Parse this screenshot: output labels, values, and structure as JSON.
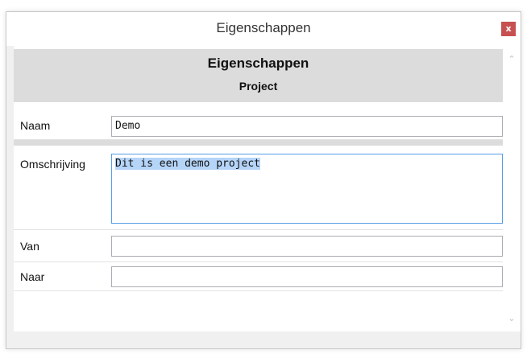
{
  "window": {
    "title": "Eigenschappen",
    "close_glyph": "x"
  },
  "header": {
    "title": "Eigenschappen",
    "subtitle": "Project"
  },
  "fields": {
    "naam": {
      "label": "Naam",
      "value": "Demo"
    },
    "omschrijving": {
      "label": "Omschrijving",
      "value": "Dit is een demo project",
      "selected": true
    },
    "van": {
      "label": "Van",
      "value": ""
    },
    "naar": {
      "label": "Naar",
      "value": ""
    }
  },
  "scrollbar": {
    "up_glyph": "⌃",
    "down_glyph": "⌄"
  },
  "colors": {
    "close_button": "#c75050",
    "header_bg": "#dcdcdc",
    "selection": "#b5d5f8",
    "focus_border": "#569de5"
  }
}
